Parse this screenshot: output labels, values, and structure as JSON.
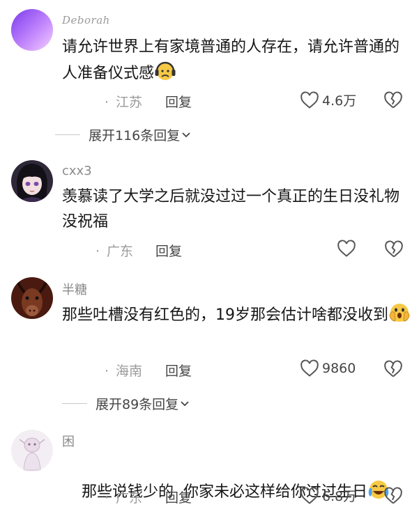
{
  "comments": [
    {
      "username": "Deborah",
      "text": "请允许世界上有家境普通的人存在，请允许普通的人准备仪式感",
      "location": "江苏",
      "reply_label": "回复",
      "likes": "4.6万",
      "emoji": "sad-headphone-emoji",
      "more_replies": "展开116条回复"
    },
    {
      "username": "cxx3",
      "text": "羡慕读了大学之后就没过过一个真正的生日没礼物没祝福",
      "location": "广东",
      "reply_label": "回复",
      "likes": ""
    },
    {
      "username": "半糖",
      "text": "那些吐槽没有红色的，19岁那会估计啥都没收到",
      "location": "海南",
      "reply_label": "回复",
      "likes": "9860",
      "emoji": "shocked-hands-emoji",
      "more_replies": "展开89条回复"
    },
    {
      "username": "困",
      "text": "那些说钱少的  你家未必这样给你过过生日",
      "location": "广东",
      "reply_label": "回复",
      "likes": "6.8万",
      "emoji": "crying-laugh-emoji"
    }
  ],
  "colors": {
    "text": "#161616",
    "meta": "#9b9b9b",
    "accent_purple": "#a855f7"
  }
}
